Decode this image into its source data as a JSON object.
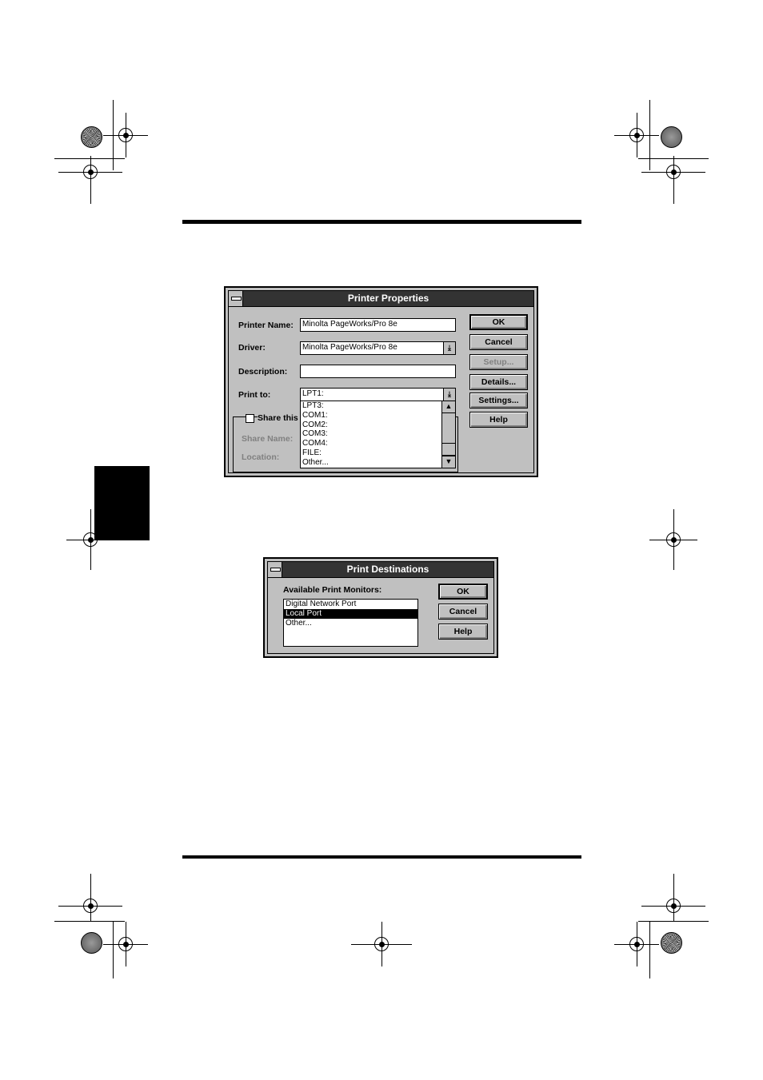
{
  "dialog1": {
    "title": "Printer Properties",
    "printer_name_label": "Printer Name:",
    "printer_name_value": "Minolta PageWorks/Pro 8e",
    "driver_label": "Driver:",
    "driver_value": "Minolta PageWorks/Pro 8e",
    "description_label": "Description:",
    "description_value": "",
    "print_to_label": "Print to:",
    "print_to_value": "LPT1:",
    "ports": [
      "LPT3:",
      "COM1:",
      "COM2:",
      "COM3:",
      "COM4:",
      "FILE:",
      "Other..."
    ],
    "share_label": "Share this",
    "share_name_label": "Share Name:",
    "location_label": "Location:",
    "buttons": {
      "ok": "OK",
      "cancel": "Cancel",
      "setup": "Setup...",
      "details": "Details...",
      "settings": "Settings...",
      "help": "Help"
    }
  },
  "dialog2": {
    "title": "Print Destinations",
    "monitors_label": "Available Print Monitors:",
    "monitors": [
      "Digital Network Port",
      "Local Port",
      "Other..."
    ],
    "selected_index": 1,
    "buttons": {
      "ok": "OK",
      "cancel": "Cancel",
      "help": "Help"
    }
  }
}
